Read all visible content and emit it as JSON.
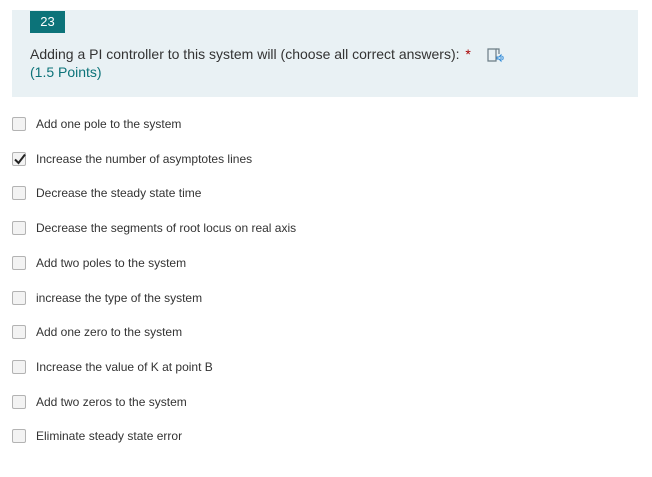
{
  "question": {
    "number": "23",
    "title": "Adding a PI controller to this system will (choose all correct answers):",
    "required_mark": "*",
    "points": "(1.5 Points)",
    "read_aloud_icon": "immersive-reader-icon"
  },
  "options": [
    {
      "label": "Add one pole to the system",
      "checked": false
    },
    {
      "label": "Increase the number of asymptotes lines",
      "checked": true
    },
    {
      "label": "Decrease the steady state time",
      "checked": false
    },
    {
      "label": "Decrease the segments of root locus on real axis",
      "checked": false
    },
    {
      "label": "Add two poles to the system",
      "checked": false
    },
    {
      "label": "increase the type of the system",
      "checked": false
    },
    {
      "label": "Add one zero to the system",
      "checked": false
    },
    {
      "label": "Increase the value of K at point B",
      "checked": false
    },
    {
      "label": "Add two zeros to the system",
      "checked": false
    },
    {
      "label": "Eliminate steady state error",
      "checked": false
    }
  ],
  "colors": {
    "header_bg": "#e9f1f4",
    "badge_bg": "#0c7379",
    "points_text": "#0c7379",
    "required": "#a80000"
  }
}
